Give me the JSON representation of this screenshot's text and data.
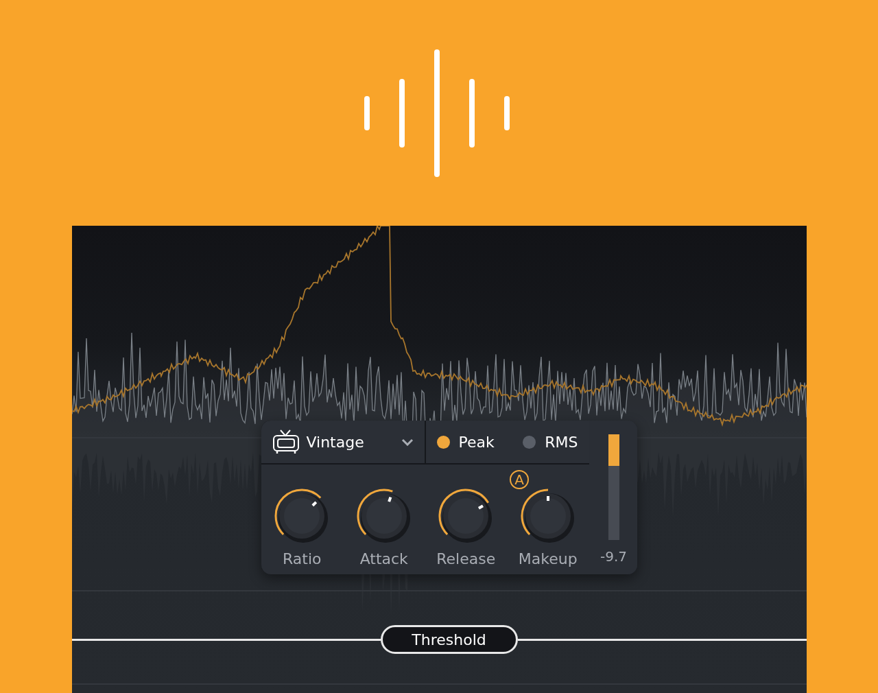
{
  "preset": {
    "label": "Vintage"
  },
  "detection": [
    {
      "label": "Peak",
      "selected": true
    },
    {
      "label": "RMS",
      "selected": false
    }
  ],
  "auto_badge": "A",
  "knobs": [
    {
      "label": "Ratio",
      "auto": false
    },
    {
      "label": "Attack",
      "auto": false
    },
    {
      "label": "Release",
      "auto": false
    },
    {
      "label": "Makeup",
      "auto": true
    }
  ],
  "meter": {
    "level": 0.3,
    "reading": "-9.7"
  },
  "threshold": {
    "label": "Threshold"
  }
}
